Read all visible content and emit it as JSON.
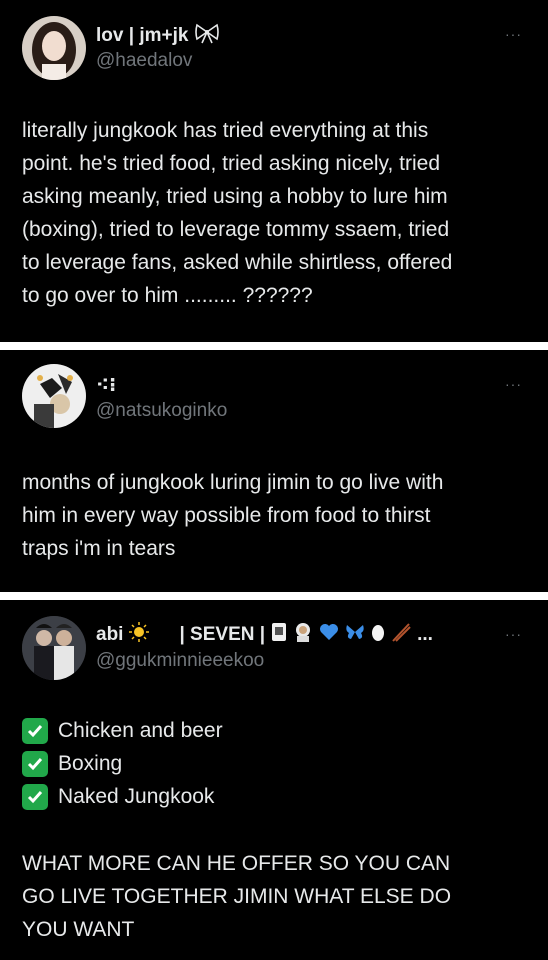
{
  "tweets": [
    {
      "name": "lov | jm+jk",
      "name_emoji": "𐀪",
      "handle": "@haedalov",
      "more": "···",
      "text": "literally jungkook has tried everything at this\npoint. he's tried food, tried asking nicely, tried\nasking meanly, tried using a hobby to lure him\n(boxing), tried to leverage tommy ssaem, tried\nto leverage fans, asked while shirtless, offered\nto go over to him ......... ??????"
    },
    {
      "name": "⁖⁝",
      "handle": "@natsukoginko",
      "more": "···",
      "text": "months of jungkook luring jimin to go live with\nhim in every way possible from food to thirst\ntraps i'm in tears"
    },
    {
      "name": "abi",
      "name_suffix": "| SEVEN |",
      "name_tail": "...",
      "handle": "@ggukminnieeekoo",
      "more": "···",
      "checklist": [
        "Chicken and beer",
        "Boxing",
        "Naked Jungkook"
      ],
      "text": "WHAT MORE CAN HE OFFER SO YOU CAN\nGO LIVE TOGETHER JIMIN WHAT ELSE DO\nYOU WANT"
    }
  ],
  "colors": {
    "background": "#000000",
    "divider": "#ffffff",
    "text": "#e7e9ea",
    "muted": "#71767b",
    "check": "#21a84a"
  }
}
